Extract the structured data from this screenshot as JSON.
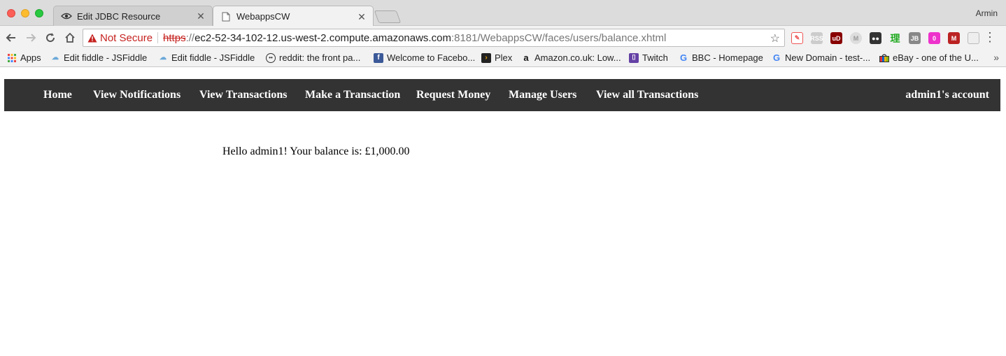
{
  "window": {
    "profile_name": "Armin"
  },
  "tabs": [
    {
      "title": "Edit JDBC Resource",
      "active": false,
      "icon": "eye-icon"
    },
    {
      "title": "WebappsCW",
      "active": true,
      "icon": "page-icon"
    }
  ],
  "toolbar": {
    "security_label": "Not Secure",
    "url_scheme": "https",
    "url_separator": "://",
    "url_host": "ec2-52-34-102-12.us-west-2.compute.amazonaws.com",
    "url_path": ":8181/WebappsCW/faces/users/balance.xhtml"
  },
  "bookmarks": [
    {
      "label": "Apps",
      "icon": "apps-grid-icon"
    },
    {
      "label": "Edit fiddle - JSFiddle",
      "icon": "jsfiddle-icon"
    },
    {
      "label": "Edit fiddle - JSFiddle",
      "icon": "jsfiddle-icon"
    },
    {
      "label": "reddit: the front pa...",
      "icon": "reddit-icon"
    },
    {
      "label": "Welcome to Facebo...",
      "icon": "facebook-icon"
    },
    {
      "label": "Plex",
      "icon": "plex-icon"
    },
    {
      "label": "Amazon.co.uk: Low...",
      "icon": "amazon-icon"
    },
    {
      "label": "Twitch",
      "icon": "twitch-icon"
    },
    {
      "label": "BBC - Homepage",
      "icon": "google-icon"
    },
    {
      "label": "New Domain - test-...",
      "icon": "google-icon"
    },
    {
      "label": "eBay - one of the U...",
      "icon": "ebay-icon"
    }
  ],
  "navbar": {
    "links": [
      "Home",
      "View Notifications",
      "View Transactions",
      "Make a Transaction",
      "Request Money",
      "Manage Users",
      "View all Transactions"
    ],
    "account_label": "admin1's account"
  },
  "main": {
    "balance_message": "Hello admin1! Your balance is: £1,000.00"
  },
  "colors": {
    "navbar_bg": "#333333",
    "navbar_text": "#ffffff",
    "not_secure": "#c5221f"
  }
}
